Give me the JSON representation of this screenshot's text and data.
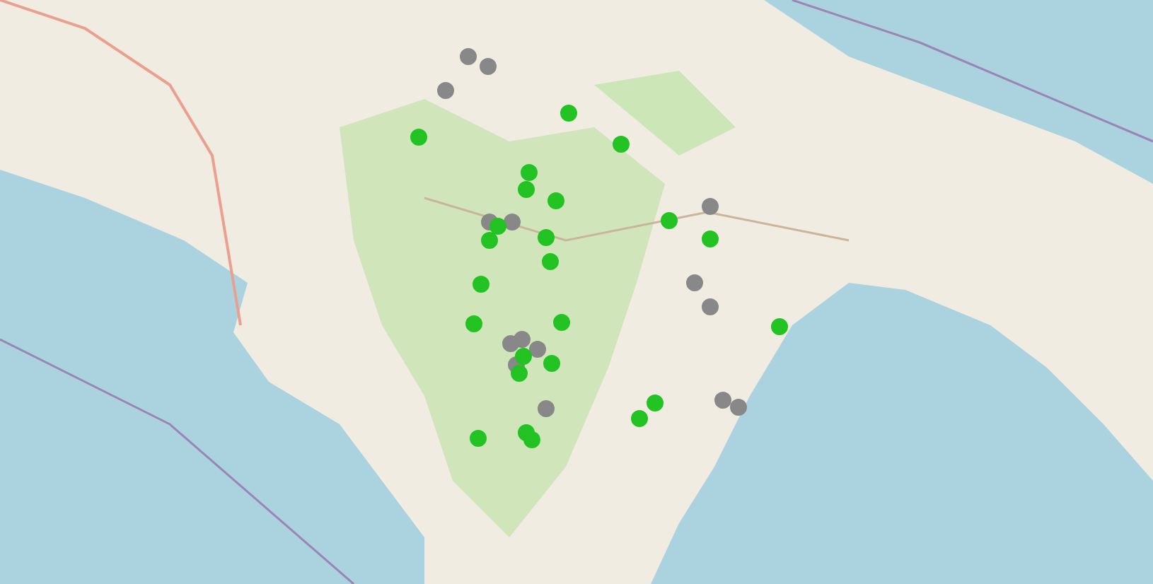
{
  "map": {
    "markers": [
      {
        "color": "#888888"
      },
      {
        "color": "#888888"
      },
      {
        "color": "#888888"
      },
      {
        "color": "#888888"
      },
      {
        "color": "#888888"
      },
      {
        "color": "#888888"
      },
      {
        "color": "#888888"
      },
      {
        "color": "#888888"
      },
      {
        "color": "#888888"
      },
      {
        "color": "#888888"
      },
      {
        "color": "#888888"
      },
      {
        "color": "#888888"
      },
      {
        "color": "#888888"
      },
      {
        "color": "#888888"
      },
      {
        "color": "#888888"
      },
      {
        "color": "#22c322"
      },
      {
        "color": "#22c322"
      },
      {
        "color": "#22c322"
      },
      {
        "color": "#22c322"
      },
      {
        "color": "#22c322"
      },
      {
        "color": "#22c322"
      },
      {
        "color": "#22c322"
      },
      {
        "color": "#22c322"
      },
      {
        "color": "#22c322"
      },
      {
        "color": "#22c322"
      },
      {
        "color": "#22c322"
      },
      {
        "color": "#22c322"
      },
      {
        "color": "#22c322"
      },
      {
        "color": "#22c322"
      },
      {
        "color": "#22c322"
      },
      {
        "color": "#22c322"
      },
      {
        "color": "#22c322"
      },
      {
        "color": "#22c322"
      },
      {
        "color": "#22c322"
      },
      {
        "color": "#22c322"
      },
      {
        "color": "#22c322"
      },
      {
        "color": "#22c322"
      },
      {
        "color": "#22c322"
      },
      {
        "color": "#22c322"
      }
    ]
  }
}
